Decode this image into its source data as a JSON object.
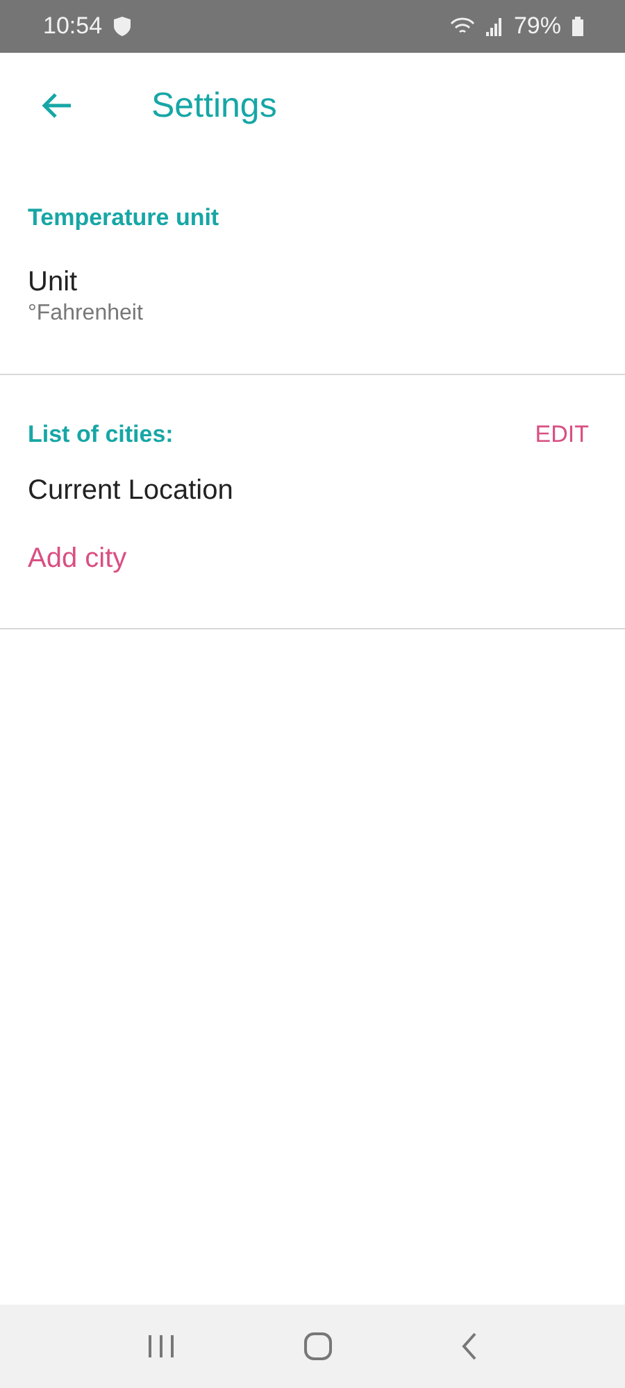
{
  "status_bar": {
    "time": "10:54",
    "battery": "79%"
  },
  "header": {
    "title": "Settings"
  },
  "sections": [
    {
      "heading": "Temperature unit",
      "items": [
        {
          "kind": "setting",
          "label": "Unit",
          "value": "°Fahrenheit"
        }
      ]
    },
    {
      "heading": "List of cities:",
      "action": "EDIT",
      "items": [
        {
          "kind": "city",
          "label": "Current Location"
        },
        {
          "kind": "add",
          "label": "Add city"
        }
      ]
    }
  ]
}
